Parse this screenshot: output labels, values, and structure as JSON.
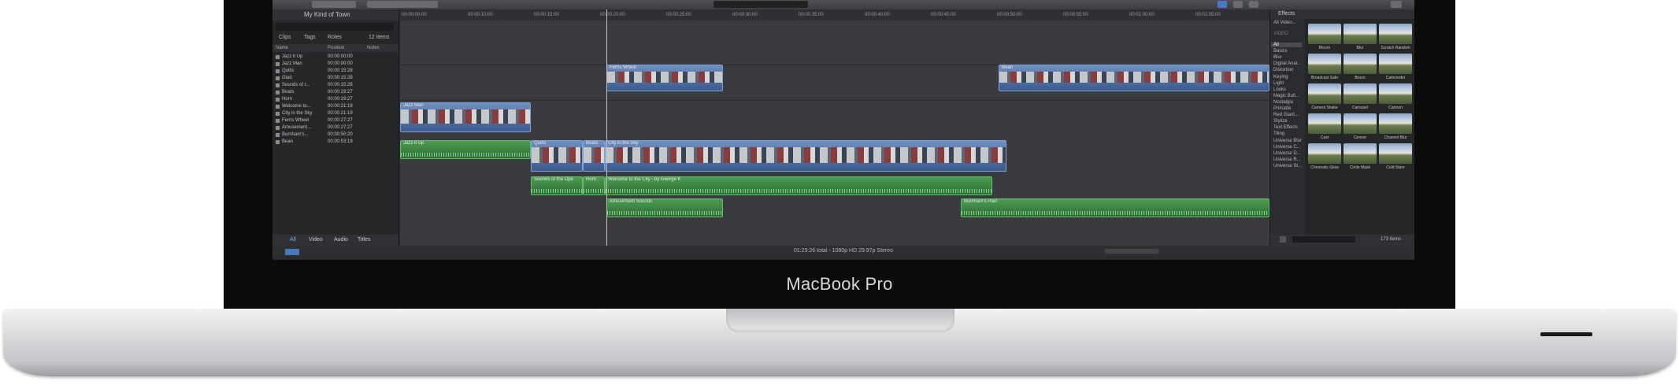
{
  "device": {
    "brand_label": "MacBook Pro"
  },
  "library": {
    "title": "My Kind of Town",
    "tabs": [
      "Clips",
      "Tags",
      "Roles"
    ],
    "count": "12 items",
    "columns": [
      "Name",
      "Position",
      "Notes"
    ],
    "rows": [
      {
        "name": "Jazz it Up",
        "pos": "00:00:00:00"
      },
      {
        "name": "Jazz Man",
        "pos": "00:00:00:00"
      },
      {
        "name": "Quilts",
        "pos": "00:00:15:28"
      },
      {
        "name": "Glad",
        "pos": "00:00:15:28"
      },
      {
        "name": "Sounds of t...",
        "pos": "00:00:15:28"
      },
      {
        "name": "Boats",
        "pos": "00:00:19:27"
      },
      {
        "name": "Horn",
        "pos": "00:00:19:27"
      },
      {
        "name": "Welcome to...",
        "pos": "00:00:21:19"
      },
      {
        "name": "City in the Sky",
        "pos": "00:00:21:19"
      },
      {
        "name": "Ferris Wheel",
        "pos": "00:00:27:27"
      },
      {
        "name": "Amusement...",
        "pos": "00:00:27:27"
      },
      {
        "name": "Burnham's...",
        "pos": "00:00:50:20"
      },
      {
        "name": "Bean",
        "pos": "00:00:53:19"
      }
    ],
    "footer_tabs": [
      "All",
      "Video",
      "Audio",
      "Titles"
    ]
  },
  "timeline": {
    "ruler": [
      "00:00:00:00",
      "00:00:10:00",
      "00:00:15:00",
      "00:00:20:00",
      "00:00:25:00",
      "00:00:30:00",
      "00:00:35:00",
      "00:00:40:00",
      "00:00:45:00",
      "00:00:50:00",
      "00:00:55:00",
      "00:01:00:00",
      "00:01:05:00"
    ],
    "clips": {
      "ferris_wheel": "Ferris Wheel",
      "bean": "Bean",
      "jazz_man": "Jazz Man",
      "jazz_it_up": "Jazz it Up",
      "quilts": "Quilts",
      "boats": "Boats",
      "city_sky": "City in the Sky",
      "sounds": "Sounds of the Ope",
      "horn": "Horn",
      "welcome": "Welcome to the City - by George K",
      "amusement": "Amusement Sounds",
      "burnham": "Burnham's Plan"
    }
  },
  "effects": {
    "title": "Effects",
    "subtitle": "All Video...",
    "section": "VIDEO",
    "categories": [
      "All",
      "Basics",
      "Blur",
      "Digital Anal...",
      "Distortion",
      "Keying",
      "Light",
      "Looks",
      "Magic Bull...",
      "Nostalgia",
      "Primatte",
      "Red Giant...",
      "Stylize",
      "Text Effects",
      "Tiling",
      "Universe Blur",
      "Universe C...",
      "Universe D...",
      "Universe R...",
      "Universe St..."
    ],
    "thumbs": [
      "Bloom",
      "Blur",
      "Scratch Random",
      "Broadcast Safe",
      "Bruno",
      "Camcorder",
      "Camera Shake",
      "Carousel",
      "Cartoon",
      "Cast",
      "Censor",
      "Channel Blur",
      "Chromatic Glow",
      "Circle Mask",
      "Cold Stare"
    ],
    "count": "173 items"
  },
  "status": {
    "text": "01:29:26 total - 1080p HD 29.97p Stereo"
  }
}
